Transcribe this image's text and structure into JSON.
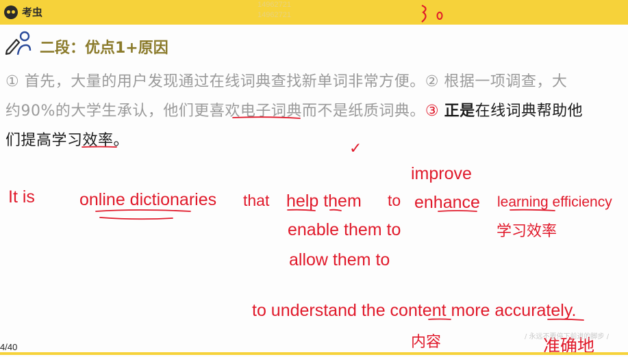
{
  "topbar": {
    "logo_text": "考虫",
    "watermark_1": "14962721",
    "watermark_2": "14962721",
    "scrawl": "} o"
  },
  "heading": {
    "title": "二段：优点1+原因"
  },
  "paragraph": {
    "line1": "① 首先，大量的用户发现通过在线词典查找新单词非常方便。② 根据一项调查，大",
    "line2_a": "约90%的大学生承认，他们更喜欢电子词典而不是纸质词典。",
    "line2_num": "③",
    "line2_b": "正是",
    "line2_c": "在线词典帮助他",
    "line3": "们提高学习效率。"
  },
  "annotations": {
    "it_is": "It is",
    "online_dictionaries": "online dictionaries",
    "that": "that",
    "help_them": "help them",
    "to": "to",
    "improve": "improve",
    "enhance": "enhance",
    "learning_efficiency": "learning efficiency",
    "xuexi_xiaolv": "学习效率",
    "enable_them_to": "enable them to",
    "allow_them_to": "allow them to",
    "understand_sentence": "to understand the content more accurately.",
    "neirong": "内容",
    "zhunquedi": "准确地",
    "checkmark": "✓"
  },
  "footer": {
    "page": "4/40",
    "slogan": "/ 永远不要停下前进的脚步 /"
  },
  "colors": {
    "ink_red": "#e0192a",
    "accent_yellow": "#f6d23a",
    "heading_olive": "#8a7a2a"
  }
}
